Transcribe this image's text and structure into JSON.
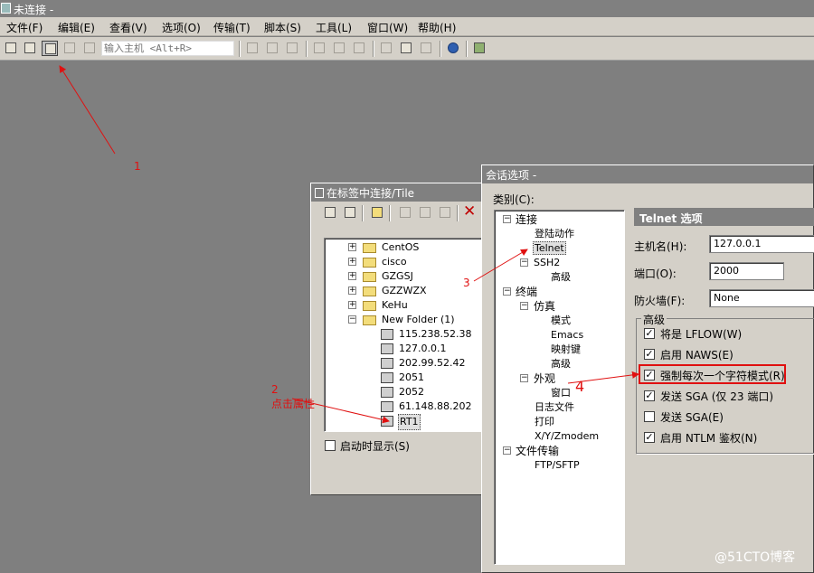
{
  "window": {
    "title": "未连接 -"
  },
  "menu": [
    "文件(F)",
    "编辑(E)",
    "查看(V)",
    "选项(O)",
    "传输(T)",
    "脚本(S)",
    "工具(L)",
    "窗口(W)",
    "帮助(H)"
  ],
  "toolbar": {
    "host_placeholder": "输入主机 <Alt+R>",
    "icons": [
      "connect-icon",
      "quick-connect-icon",
      "connect-in-tab-icon",
      "reconnect-icon",
      "disconnect-icon",
      "copy-icon",
      "paste-icon",
      "find-icon",
      "print-icon",
      "print-setup-icon",
      "print-screen-icon",
      "session-options-icon",
      "global-options-icon",
      "keymap-icon",
      "help-icon",
      "sftp-icon"
    ]
  },
  "connect_panel": {
    "title": "在标签中连接/Tile",
    "tree": [
      {
        "label": "CentOS",
        "type": "folder"
      },
      {
        "label": "cisco",
        "type": "folder"
      },
      {
        "label": "GZGSJ",
        "type": "folder"
      },
      {
        "label": "GZZWZX",
        "type": "folder"
      },
      {
        "label": "KeHu",
        "type": "folder"
      },
      {
        "label": "New Folder (1)",
        "type": "folder-open"
      },
      {
        "label": "115.238.52.38",
        "type": "session"
      },
      {
        "label": "127.0.0.1",
        "type": "session"
      },
      {
        "label": "202.99.52.42",
        "type": "session"
      },
      {
        "label": "2051",
        "type": "session"
      },
      {
        "label": "2052",
        "type": "session"
      },
      {
        "label": "61.148.88.202",
        "type": "session"
      },
      {
        "label": "RT1",
        "type": "session"
      }
    ],
    "startup_checkbox": "启动时显示(S)"
  },
  "options_dialog": {
    "title": "会话选项 -",
    "category_label": "类别(C):",
    "categories": [
      "连接",
      "登陆动作",
      "Telnet",
      "SSH2",
      "高级",
      "终端",
      "仿真",
      "模式",
      "Emacs",
      "映射键",
      "高级",
      "外观",
      "窗口",
      "日志文件",
      "打印",
      "X/Y/Zmodem",
      "文件传输",
      "FTP/SFTP"
    ],
    "section_title": "Telnet 选项",
    "hostname_label": "主机名(H):",
    "hostname_value": "127.0.0.1",
    "port_label": "端口(O):",
    "port_value": "2000",
    "firewall_label": "防火墙(F):",
    "firewall_value": "None",
    "advanced_label": "高级",
    "options": [
      {
        "label": "将是 LFLOW(W)",
        "checked": true
      },
      {
        "label": "启用 NAWS(E)",
        "checked": true
      },
      {
        "label": "强制每次一个字符模式(R)",
        "checked": true
      },
      {
        "label": "发送 SGA (仅 23 端口)",
        "checked": true
      },
      {
        "label": "发送 SGA(E)",
        "checked": false
      },
      {
        "label": "启用 NTLM 鉴权(N)",
        "checked": true
      }
    ]
  },
  "annotations": {
    "a1": "1",
    "a2": "2",
    "a2_text": "点击属性",
    "a3": "3",
    "a4": "4"
  },
  "watermark": "@51CTO博客",
  "colors": {
    "annotation": "#e01010",
    "title_bar": "#808080",
    "dialog_face": "#d4d0c8"
  }
}
